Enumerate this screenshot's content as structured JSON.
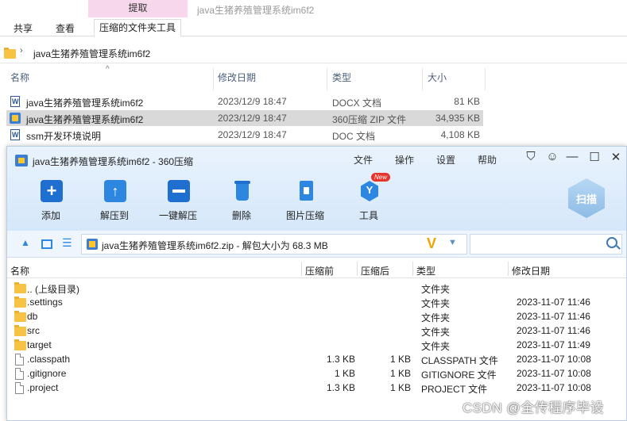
{
  "explorer": {
    "context_tab": "提取",
    "title": "java生猪养殖管理系统im6f2",
    "tabs": [
      "共享",
      "查看",
      "压缩的文件夹工具"
    ],
    "address": "java生猪养殖管理系统im6f2",
    "columns": {
      "name": "名称",
      "modified": "修改日期",
      "type": "类型",
      "size": "大小"
    },
    "files": [
      {
        "name": "java生猪养殖管理系统im6f2",
        "modified": "2023/12/9 18:47",
        "type": "DOCX 文档",
        "size": "81 KB",
        "icon": "word-doc-icon"
      },
      {
        "name": "java生猪养殖管理系统im6f2",
        "modified": "2023/12/9 18:47",
        "type": "360压缩 ZIP 文件",
        "size": "34,935 KB",
        "icon": "zip-icon",
        "selected": true
      },
      {
        "name": "ssm开发环境说明",
        "modified": "2023/12/9 18:47",
        "type": "DOC 文档",
        "size": "4,108 KB",
        "icon": "word-doc-icon"
      }
    ]
  },
  "zip": {
    "title": "java生猪养殖管理系统im6f2 - 360压缩",
    "menu": [
      "文件",
      "操作",
      "设置",
      "帮助"
    ],
    "window_controls": [
      "shirt-icon",
      "feedback-icon",
      "minimize-icon",
      "maximize-icon",
      "close-icon"
    ],
    "toolbar": [
      {
        "label": "添加",
        "icon": "add-icon"
      },
      {
        "label": "解压到",
        "icon": "extract-to-icon"
      },
      {
        "label": "一键解压",
        "icon": "one-click-extract-icon"
      },
      {
        "label": "删除",
        "icon": "delete-icon"
      },
      {
        "label": "图片压缩",
        "icon": "image-compress-icon"
      },
      {
        "label": "工具",
        "icon": "tools-icon"
      }
    ],
    "new_badge": "New",
    "scan_label": "扫描",
    "path": "java生猪养殖管理系统im6f2.zip - 解包大小为 68.3 MB",
    "search_placeholder": "",
    "columns": {
      "name": "名称",
      "compressed": "压缩前",
      "after": "压缩后",
      "type": "类型",
      "modified": "修改日期"
    },
    "entries": [
      {
        "name": ".. (上级目录)",
        "before": "",
        "after": "",
        "type": "文件夹",
        "modified": "",
        "kind": "folder"
      },
      {
        "name": ".settings",
        "before": "",
        "after": "",
        "type": "文件夹",
        "modified": "2023-11-07 11:46",
        "kind": "folder"
      },
      {
        "name": "db",
        "before": "",
        "after": "",
        "type": "文件夹",
        "modified": "2023-11-07 11:46",
        "kind": "folder"
      },
      {
        "name": "src",
        "before": "",
        "after": "",
        "type": "文件夹",
        "modified": "2023-11-07 11:46",
        "kind": "folder"
      },
      {
        "name": "target",
        "before": "",
        "after": "",
        "type": "文件夹",
        "modified": "2023-11-07 11:49",
        "kind": "folder"
      },
      {
        "name": ".classpath",
        "before": "1.3 KB",
        "after": "1 KB",
        "type": "CLASSPATH 文件",
        "modified": "2023-11-07 10:08",
        "kind": "file"
      },
      {
        "name": ".gitignore",
        "before": "1 KB",
        "after": "1 KB",
        "type": "GITIGNORE 文件",
        "modified": "2023-11-07 10:08",
        "kind": "file"
      },
      {
        "name": ".project",
        "before": "1.3 KB",
        "after": "1 KB",
        "type": "PROJECT 文件",
        "modified": "2023-11-07 10:08",
        "kind": "file"
      }
    ]
  },
  "watermark": "CSDN @全传程序毕设",
  "colors": {
    "accent": "#2d86e0",
    "context_tab": "#f7d7ec",
    "folder": "#f6c344",
    "selection": "#d9d9d9"
  }
}
